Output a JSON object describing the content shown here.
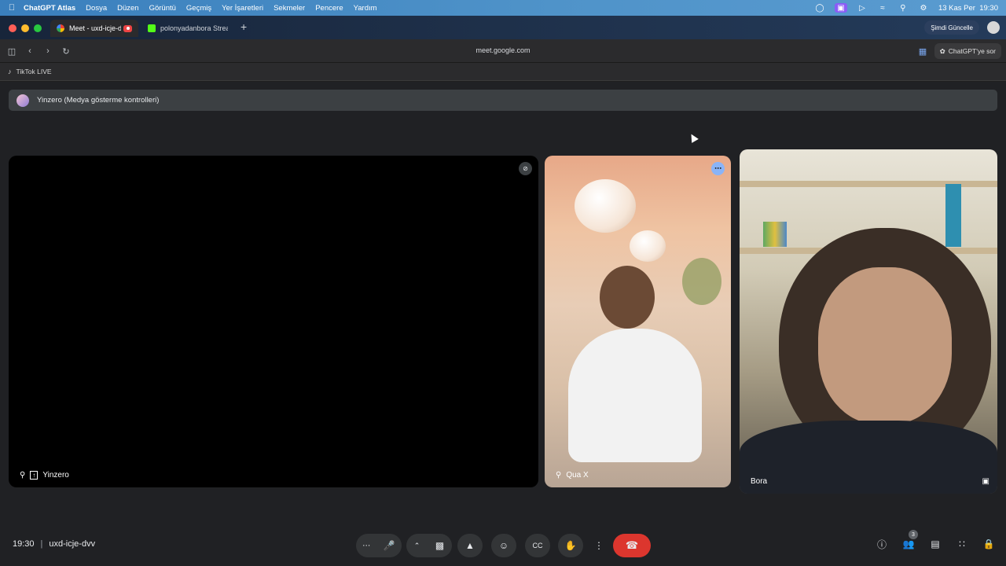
{
  "menubar": {
    "app": "ChatGPT Atlas",
    "items": [
      "Dosya",
      "Düzen",
      "Görüntü",
      "Geçmiş",
      "Yer İşaretleri",
      "Sekmeler",
      "Pencere",
      "Yardım"
    ],
    "datetime": "13 Kas Per  19:30"
  },
  "tabs": [
    {
      "label": "Meet - uxd-icje-dvv",
      "active": true
    },
    {
      "label": "polonyadanbora Stream"
    }
  ],
  "browser": {
    "update_label": "Şimdi Güncelle",
    "url": "meet.google.com",
    "ask_label": "ChatGPT'ye sor",
    "bookmark": "TikTok LIVE"
  },
  "meet": {
    "banner": "Yinzero (Medya gösterme kontrolleri)",
    "tiles": {
      "presenter": "Yinzero",
      "qua": "Qua X",
      "bora": "Bora"
    },
    "time": "19:30",
    "meeting_code": "uxd-icje-dvv",
    "people_count": "3"
  },
  "colors": {
    "end_call": "#dc362e",
    "accent": "#8ab4f8"
  }
}
